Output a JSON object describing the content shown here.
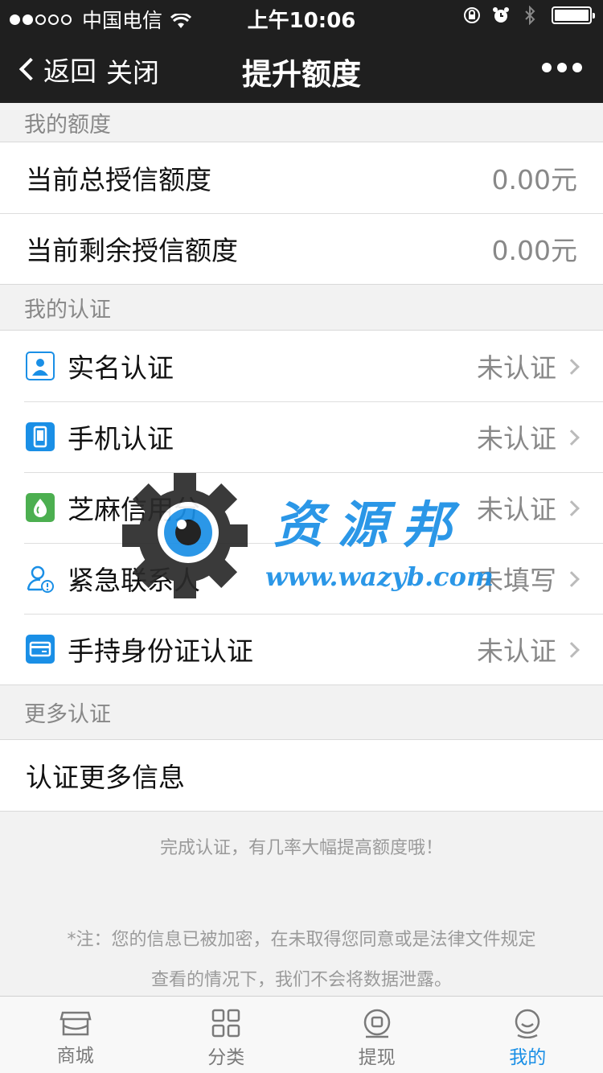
{
  "status_bar": {
    "carrier": "中国电信",
    "time": "上午10:06"
  },
  "nav": {
    "back_label": "返回",
    "close_label": "关闭",
    "title": "提升额度"
  },
  "credit": {
    "section_title": "我的额度",
    "rows": [
      {
        "label": "当前总授信额度",
        "value": "0.00元"
      },
      {
        "label": "当前剩余授信额度",
        "value": "0.00元"
      }
    ]
  },
  "auth": {
    "section_title": "我的认证",
    "rows": [
      {
        "label": "实名认证",
        "status": "未认证",
        "icon": "id-person-icon",
        "color": "#1a8fe6"
      },
      {
        "label": "手机认证",
        "status": "未认证",
        "icon": "phone-icon",
        "color": "#1a8fe6"
      },
      {
        "label": "芝麻信用分",
        "status": "未认证",
        "icon": "sesame-icon",
        "color": "#4caf50"
      },
      {
        "label": "紧急联系人",
        "status": "未填写",
        "icon": "contact-icon",
        "color": "#1a8fe6"
      },
      {
        "label": "手持身份证认证",
        "status": "未认证",
        "icon": "id-card-icon",
        "color": "#1a8fe6"
      }
    ]
  },
  "more": {
    "section_title": "更多认证",
    "row_label": "认证更多信息"
  },
  "tip": "完成认证，有几率大幅提高额度哦！",
  "note_lines": [
    "*注：您的信息已被加密，在未取得您同意或是法律文件规定",
    "查看的情况下，我们不会将数据泄露。"
  ],
  "tabs": [
    {
      "label": "商城",
      "icon": "store-icon",
      "active": false
    },
    {
      "label": "分类",
      "icon": "grid-icon",
      "active": false
    },
    {
      "label": "提现",
      "icon": "withdraw-icon",
      "active": false
    },
    {
      "label": "我的",
      "icon": "user-icon",
      "active": true
    }
  ],
  "watermark": {
    "text": "资源邦",
    "url": "www.wazyb.com"
  },
  "colors": {
    "accent": "#1a8fe6",
    "nav_bg": "#1f1f1f",
    "page_bg": "#f2f2f2"
  }
}
